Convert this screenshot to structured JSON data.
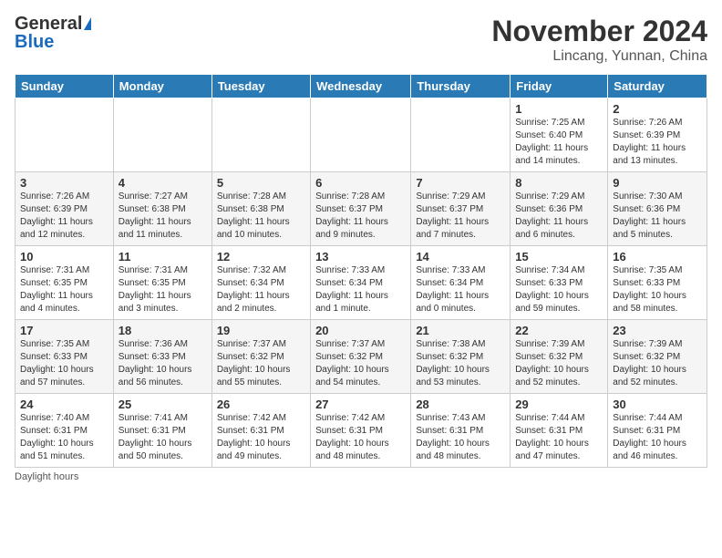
{
  "logo": {
    "general": "General",
    "blue": "Blue"
  },
  "title": "November 2024",
  "subtitle": "Lincang, Yunnan, China",
  "days_header": [
    "Sunday",
    "Monday",
    "Tuesday",
    "Wednesday",
    "Thursday",
    "Friday",
    "Saturday"
  ],
  "footer_label": "Daylight hours",
  "weeks": [
    [
      {
        "day": "",
        "info": ""
      },
      {
        "day": "",
        "info": ""
      },
      {
        "day": "",
        "info": ""
      },
      {
        "day": "",
        "info": ""
      },
      {
        "day": "",
        "info": ""
      },
      {
        "day": "1",
        "info": "Sunrise: 7:25 AM\nSunset: 6:40 PM\nDaylight: 11 hours and 14 minutes."
      },
      {
        "day": "2",
        "info": "Sunrise: 7:26 AM\nSunset: 6:39 PM\nDaylight: 11 hours and 13 minutes."
      }
    ],
    [
      {
        "day": "3",
        "info": "Sunrise: 7:26 AM\nSunset: 6:39 PM\nDaylight: 11 hours and 12 minutes."
      },
      {
        "day": "4",
        "info": "Sunrise: 7:27 AM\nSunset: 6:38 PM\nDaylight: 11 hours and 11 minutes."
      },
      {
        "day": "5",
        "info": "Sunrise: 7:28 AM\nSunset: 6:38 PM\nDaylight: 11 hours and 10 minutes."
      },
      {
        "day": "6",
        "info": "Sunrise: 7:28 AM\nSunset: 6:37 PM\nDaylight: 11 hours and 9 minutes."
      },
      {
        "day": "7",
        "info": "Sunrise: 7:29 AM\nSunset: 6:37 PM\nDaylight: 11 hours and 7 minutes."
      },
      {
        "day": "8",
        "info": "Sunrise: 7:29 AM\nSunset: 6:36 PM\nDaylight: 11 hours and 6 minutes."
      },
      {
        "day": "9",
        "info": "Sunrise: 7:30 AM\nSunset: 6:36 PM\nDaylight: 11 hours and 5 minutes."
      }
    ],
    [
      {
        "day": "10",
        "info": "Sunrise: 7:31 AM\nSunset: 6:35 PM\nDaylight: 11 hours and 4 minutes."
      },
      {
        "day": "11",
        "info": "Sunrise: 7:31 AM\nSunset: 6:35 PM\nDaylight: 11 hours and 3 minutes."
      },
      {
        "day": "12",
        "info": "Sunrise: 7:32 AM\nSunset: 6:34 PM\nDaylight: 11 hours and 2 minutes."
      },
      {
        "day": "13",
        "info": "Sunrise: 7:33 AM\nSunset: 6:34 PM\nDaylight: 11 hours and 1 minute."
      },
      {
        "day": "14",
        "info": "Sunrise: 7:33 AM\nSunset: 6:34 PM\nDaylight: 11 hours and 0 minutes."
      },
      {
        "day": "15",
        "info": "Sunrise: 7:34 AM\nSunset: 6:33 PM\nDaylight: 10 hours and 59 minutes."
      },
      {
        "day": "16",
        "info": "Sunrise: 7:35 AM\nSunset: 6:33 PM\nDaylight: 10 hours and 58 minutes."
      }
    ],
    [
      {
        "day": "17",
        "info": "Sunrise: 7:35 AM\nSunset: 6:33 PM\nDaylight: 10 hours and 57 minutes."
      },
      {
        "day": "18",
        "info": "Sunrise: 7:36 AM\nSunset: 6:33 PM\nDaylight: 10 hours and 56 minutes."
      },
      {
        "day": "19",
        "info": "Sunrise: 7:37 AM\nSunset: 6:32 PM\nDaylight: 10 hours and 55 minutes."
      },
      {
        "day": "20",
        "info": "Sunrise: 7:37 AM\nSunset: 6:32 PM\nDaylight: 10 hours and 54 minutes."
      },
      {
        "day": "21",
        "info": "Sunrise: 7:38 AM\nSunset: 6:32 PM\nDaylight: 10 hours and 53 minutes."
      },
      {
        "day": "22",
        "info": "Sunrise: 7:39 AM\nSunset: 6:32 PM\nDaylight: 10 hours and 52 minutes."
      },
      {
        "day": "23",
        "info": "Sunrise: 7:39 AM\nSunset: 6:32 PM\nDaylight: 10 hours and 52 minutes."
      }
    ],
    [
      {
        "day": "24",
        "info": "Sunrise: 7:40 AM\nSunset: 6:31 PM\nDaylight: 10 hours and 51 minutes."
      },
      {
        "day": "25",
        "info": "Sunrise: 7:41 AM\nSunset: 6:31 PM\nDaylight: 10 hours and 50 minutes."
      },
      {
        "day": "26",
        "info": "Sunrise: 7:42 AM\nSunset: 6:31 PM\nDaylight: 10 hours and 49 minutes."
      },
      {
        "day": "27",
        "info": "Sunrise: 7:42 AM\nSunset: 6:31 PM\nDaylight: 10 hours and 48 minutes."
      },
      {
        "day": "28",
        "info": "Sunrise: 7:43 AM\nSunset: 6:31 PM\nDaylight: 10 hours and 48 minutes."
      },
      {
        "day": "29",
        "info": "Sunrise: 7:44 AM\nSunset: 6:31 PM\nDaylight: 10 hours and 47 minutes."
      },
      {
        "day": "30",
        "info": "Sunrise: 7:44 AM\nSunset: 6:31 PM\nDaylight: 10 hours and 46 minutes."
      }
    ]
  ]
}
